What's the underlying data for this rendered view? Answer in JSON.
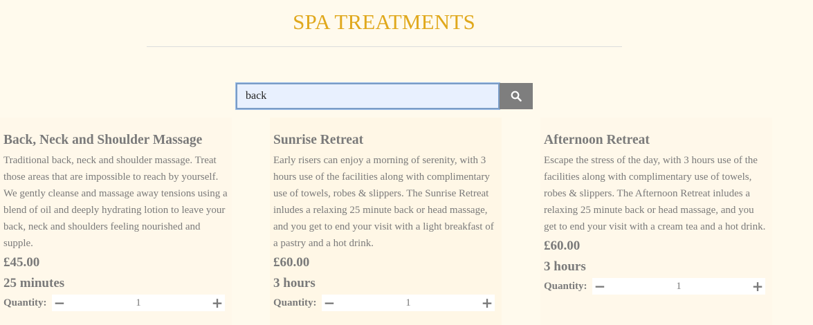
{
  "header": {
    "title": "SPA TREATMENTS"
  },
  "search": {
    "value": "back",
    "button_icon": "search-icon"
  },
  "colors": {
    "title": "#e0a81c",
    "background": "#fffaed",
    "text": "#7a7a7a",
    "search_button": "#7e7e7e"
  },
  "treatments": [
    {
      "title": "Back, Neck and Shoulder Massage",
      "description": "Traditional back, neck and shoulder massage. Treat those areas that are impossible to reach by yourself. We gently cleanse and massage away tensions using a blend of oil and deeply hydrating lotion to leave your back, neck and shoulders feeling nourished and supple.",
      "price": "£45.00",
      "duration": "25 minutes",
      "quantity_label": "Quantity:",
      "quantity": "1"
    },
    {
      "title": "Sunrise Retreat",
      "description": "Early risers can enjoy a morning of serenity, with 3 hours use of the facilities along with complimentary use of towels, robes & slippers. The Sunrise Retreat inludes a relaxing 25 minute back or head massage, and you get to end your visit with a light breakfast of a pastry and a hot drink.",
      "price": "£60.00",
      "duration": "3 hours",
      "quantity_label": "Quantity:",
      "quantity": "1"
    },
    {
      "title": "Afternoon Retreat",
      "description": "Escape the stress of the day, with 3 hours use of the facilities along with complimentary use of towels, robes & slippers. The Afternoon Retreat inludes a relaxing 25 minute back or head massage, and you get to end your visit with a cream tea and a hot drink.",
      "price": "£60.00",
      "duration": "3 hours",
      "quantity_label": "Quantity:",
      "quantity": "1"
    }
  ]
}
